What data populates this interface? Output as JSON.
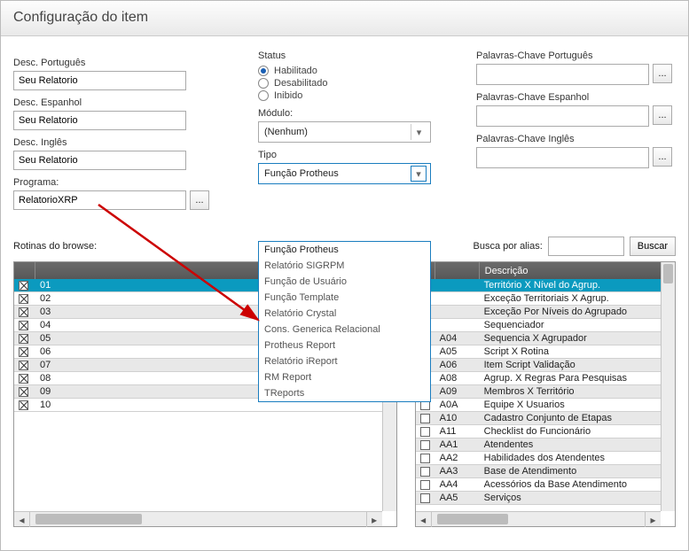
{
  "title": "Configuração do item",
  "left": {
    "desc_pt_label": "Desc. Português",
    "desc_pt_value": "Seu Relatorio",
    "desc_es_label": "Desc. Espanhol",
    "desc_es_value": "Seu Relatorio",
    "desc_en_label": "Desc. Inglês",
    "desc_en_value": "Seu Relatorio",
    "programa_label": "Programa:",
    "programa_value": "RelatorioXRP"
  },
  "center": {
    "status_label": "Status",
    "status_options": [
      "Habilitado",
      "Desabilitado",
      "Inibido"
    ],
    "status_selected": "Habilitado",
    "modulo_label": "Módulo:",
    "modulo_value": "(Nenhum)",
    "tipo_label": "Tipo",
    "tipo_value": "Função Protheus",
    "tipo_options": [
      "Função Protheus",
      "Relatório SIGRPM",
      "Função de Usuário",
      "Função Template",
      "Relatório Crystal",
      "Cons. Generica Relacional",
      "Protheus Report",
      "Relatório iReport",
      "RM Report",
      "TReports"
    ]
  },
  "right": {
    "kw_pt_label": "Palavras-Chave Português",
    "kw_es_label": "Palavras-Chave Espanhol",
    "kw_en_label": "Palavras-Chave Inglês"
  },
  "browse": {
    "rotinas_label": "Rotinas do browse:",
    "busca_label": "Busca por alias:",
    "buscar_btn": "Buscar"
  },
  "left_table": {
    "rows": [
      "01",
      "02",
      "03",
      "04",
      "05",
      "06",
      "07",
      "08",
      "09",
      "10"
    ]
  },
  "right_table": {
    "col2_header": "Descrição",
    "rows": [
      {
        "c": "",
        "d": "Território X Nível do Agrup."
      },
      {
        "c": "",
        "d": "Exceção Territoriais X Agrup."
      },
      {
        "c": "",
        "d": "Exceção Por Níveis do Agrupado"
      },
      {
        "c": "",
        "d": "Sequenciador"
      },
      {
        "c": "A04",
        "d": "Sequencia X Agrupador"
      },
      {
        "c": "A05",
        "d": "Script X Rotina"
      },
      {
        "c": "A06",
        "d": "Item Script Validação"
      },
      {
        "c": "A08",
        "d": "Agrup. X Regras Para Pesquisas"
      },
      {
        "c": "A09",
        "d": "Membros X Território"
      },
      {
        "c": "A0A",
        "d": "Equipe X Usuarios"
      },
      {
        "c": "A10",
        "d": "Cadastro Conjunto de Etapas"
      },
      {
        "c": "A11",
        "d": "Checklist do Funcionário"
      },
      {
        "c": "AA1",
        "d": "Atendentes"
      },
      {
        "c": "AA2",
        "d": "Habilidades dos Atendentes"
      },
      {
        "c": "AA3",
        "d": "Base de Atendimento"
      },
      {
        "c": "AA4",
        "d": "Acessórios da Base Atendimento"
      },
      {
        "c": "AA5",
        "d": "Serviços"
      }
    ]
  }
}
